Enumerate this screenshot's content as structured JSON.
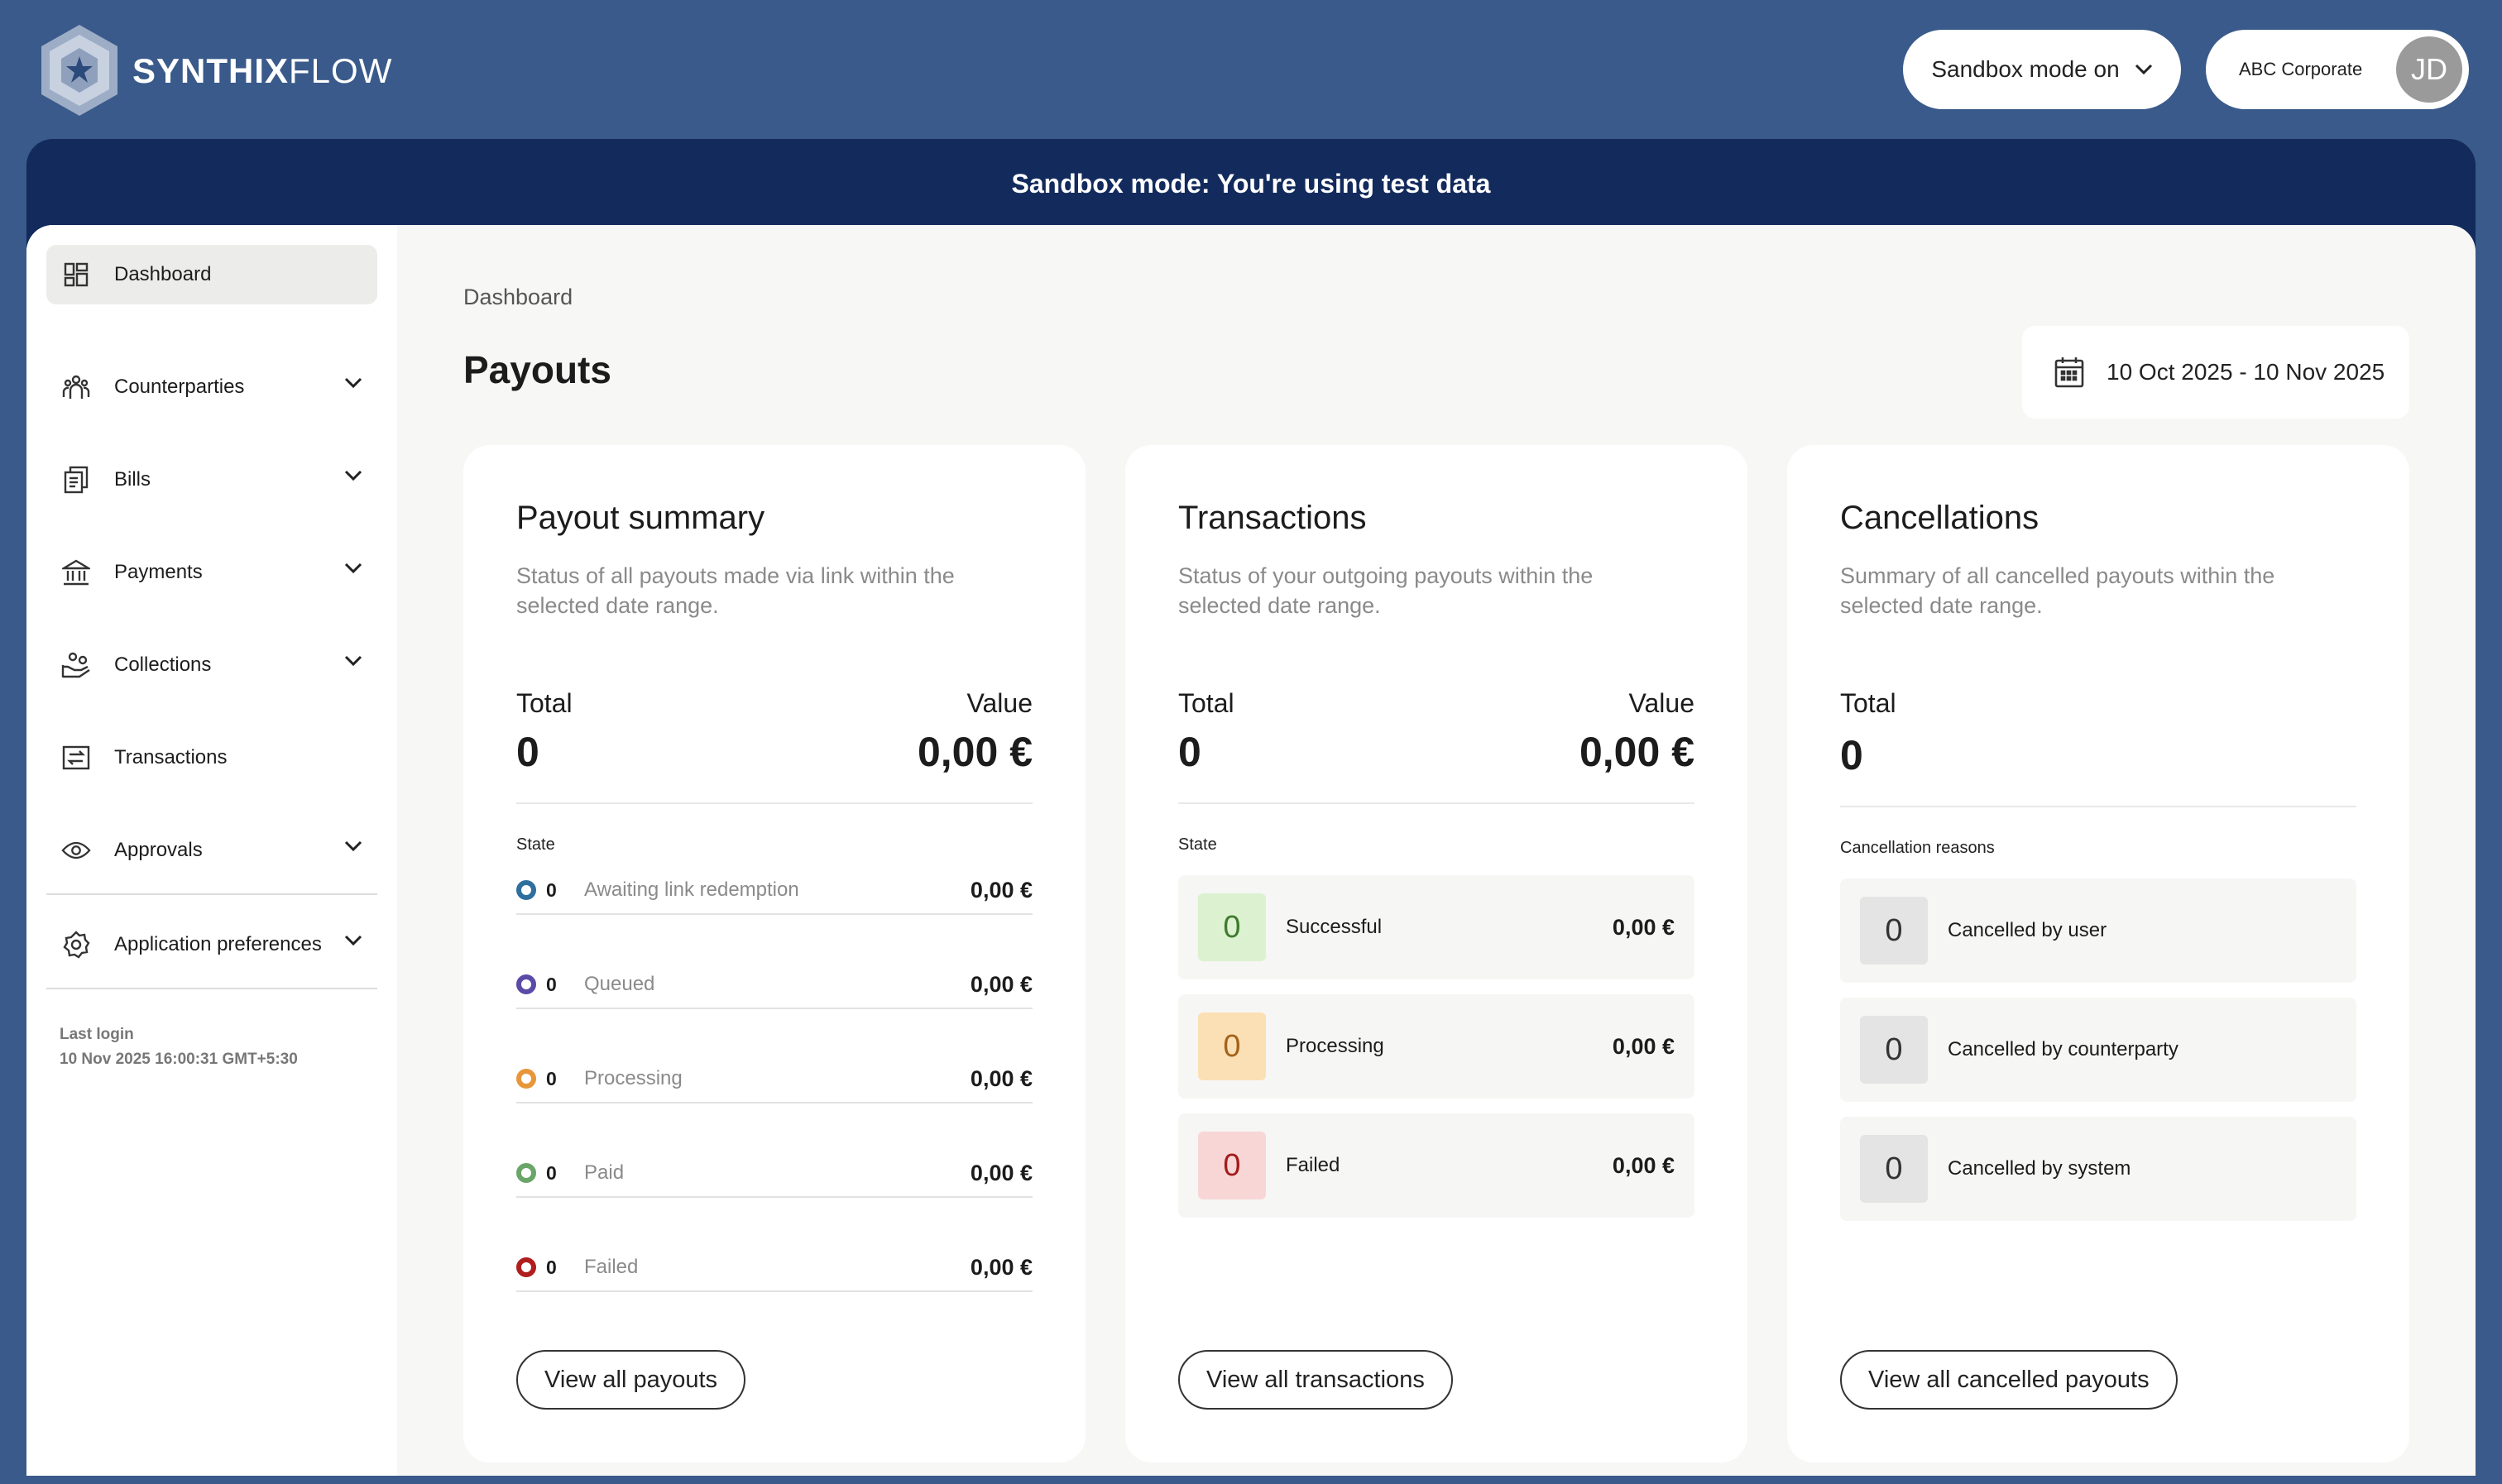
{
  "brand": {
    "name_bold": "SYNTHIX",
    "name_light": "FLOW"
  },
  "header": {
    "sandbox_select": "Sandbox mode on",
    "account_name": "ABC Corporate",
    "avatar_initials": "JD"
  },
  "banner": {
    "text": "Sandbox mode: You're using test data"
  },
  "sidebar": {
    "items": [
      {
        "label": "Dashboard",
        "icon": "dashboard-icon"
      },
      {
        "label": "Counterparties",
        "icon": "people-icon"
      },
      {
        "label": "Bills",
        "icon": "bills-icon"
      },
      {
        "label": "Payments",
        "icon": "bank-icon"
      },
      {
        "label": "Collections",
        "icon": "collections-icon"
      },
      {
        "label": "Transactions",
        "icon": "transfer-icon"
      },
      {
        "label": "Approvals",
        "icon": "eye-icon"
      },
      {
        "label": "Application preferences",
        "icon": "gear-icon"
      }
    ],
    "last_login_label": "Last login",
    "last_login_value": "10 Nov 2025 16:00:31 GMT+5:30"
  },
  "breadcrumb": "Dashboard",
  "page_title": "Payouts",
  "date_range": "10 Oct 2025 - 10 Nov 2025",
  "payout_summary": {
    "title": "Payout summary",
    "description": "Status of all payouts made via link within the selected date range.",
    "total_label": "Total",
    "value_label": "Value",
    "total": "0",
    "value": "0,00 €",
    "state_label": "State",
    "states": [
      {
        "count": "0",
        "label": "Awaiting link redemption",
        "amount": "0,00 €",
        "color": "#2e6f9e"
      },
      {
        "count": "0",
        "label": "Queued",
        "amount": "0,00 €",
        "color": "#5b4aa6"
      },
      {
        "count": "0",
        "label": "Processing",
        "amount": "0,00 €",
        "color": "#e8963a"
      },
      {
        "count": "0",
        "label": "Paid",
        "amount": "0,00 €",
        "color": "#6aa56a"
      },
      {
        "count": "0",
        "label": "Failed",
        "amount": "0,00 €",
        "color": "#b01e1e"
      }
    ],
    "button": "View all payouts"
  },
  "transactions": {
    "title": "Transactions",
    "description": "Status of your outgoing payouts within the selected date range.",
    "total_label": "Total",
    "value_label": "Value",
    "total": "0",
    "value": "0,00 €",
    "state_label": "State",
    "states": [
      {
        "count": "0",
        "label": "Successful",
        "amount": "0,00 €",
        "bg": "#dcf1cf",
        "fg": "#3f7a2f"
      },
      {
        "count": "0",
        "label": "Processing",
        "amount": "0,00 €",
        "bg": "#fbe0b5",
        "fg": "#a4631a"
      },
      {
        "count": "0",
        "label": "Failed",
        "amount": "0,00 €",
        "bg": "#f8d6d6",
        "fg": "#a21c1c"
      }
    ],
    "button": "View all transactions"
  },
  "cancellations": {
    "title": "Cancellations",
    "description": "Summary of all cancelled payouts within the selected date range.",
    "total_label": "Total",
    "total": "0",
    "reasons_label": "Cancellation reasons",
    "reasons": [
      {
        "count": "0",
        "label": "Cancelled by user"
      },
      {
        "count": "0",
        "label": "Cancelled by counterparty"
      },
      {
        "count": "0",
        "label": "Cancelled by system"
      }
    ],
    "button": "View all cancelled payouts"
  }
}
